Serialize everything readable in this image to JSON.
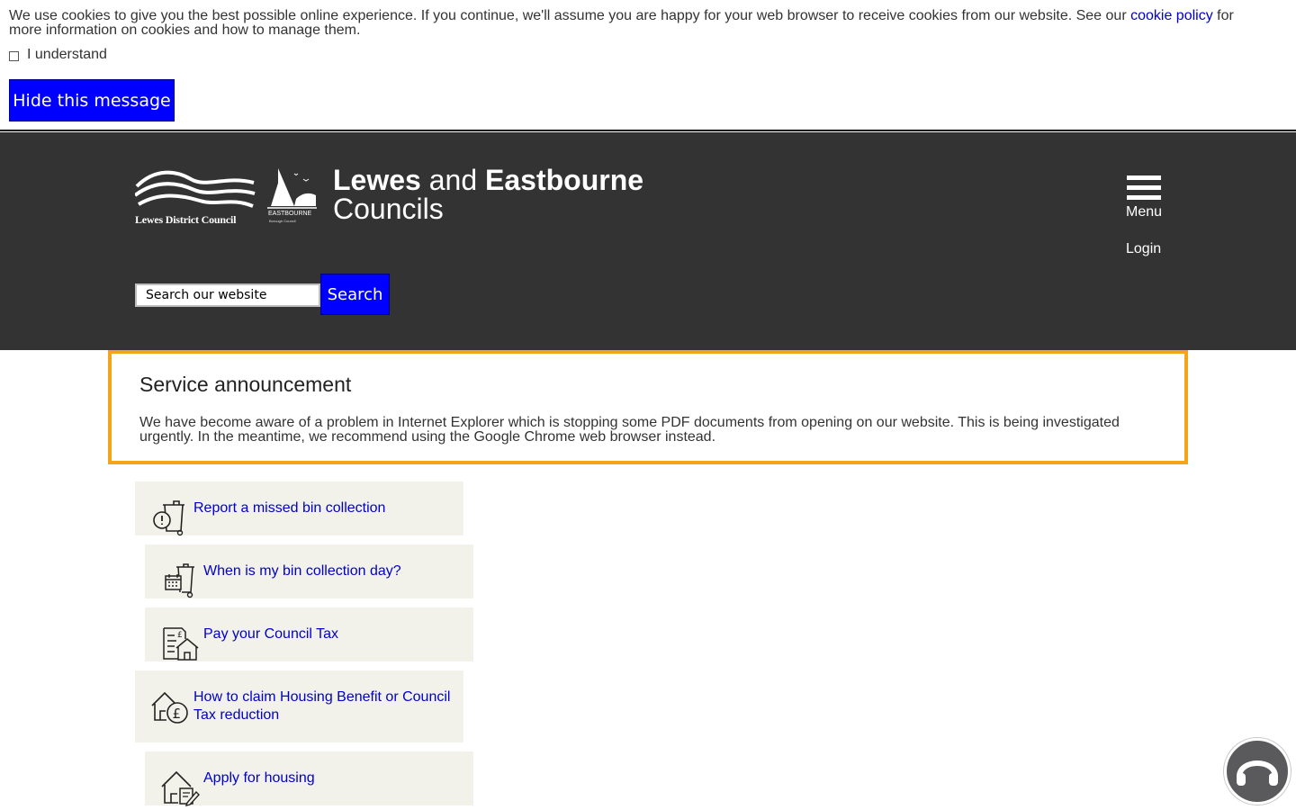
{
  "cookie_banner": {
    "text_before_link": "We use cookies to give you the best possible online experience. If you continue, we'll assume you are happy for your web browser to receive cookies from our website. See our",
    "link_text": "cookie policy",
    "text_after_link": "for more information on cookies and how to manage them.",
    "checkbox_label": "I understand",
    "hide_button_label": "Hide this message"
  },
  "header": {
    "lewes_logo_text": "Lewes District Council",
    "eastbourne_logo_text": "EASTBOURNE",
    "eastbourne_logo_subtext": "Borough Council",
    "title_word_1": "Lewes",
    "title_connector": "and",
    "title_word_2": "Eastbourne",
    "title_line_2": "Councils",
    "menu_label": "Menu",
    "login_label": "Login",
    "search_value": "Search our website",
    "search_button_label": "Search"
  },
  "announcement": {
    "title": "Service announcement",
    "text": "We have become aware of a problem in Internet Explorer which is stopping some PDF documents from opening on our website. This is being investigated urgently. In the meantime, we recommend using the Google Chrome web browser instead."
  },
  "quick_links": [
    {
      "label": "Report a missed bin collection",
      "icon": "bin-alert-icon"
    },
    {
      "label": "When is my bin collection day?",
      "icon": "bin-calendar-icon"
    },
    {
      "label": "Pay your Council Tax",
      "icon": "council-tax-icon"
    },
    {
      "label": "How to claim Housing Benefit or Council Tax reduction",
      "icon": "house-pound-icon"
    },
    {
      "label": "Apply for housing",
      "icon": "house-form-icon"
    }
  ],
  "accessibility": {
    "icon": "headphones-icon"
  },
  "colors": {
    "header_bg": "#333333",
    "button_blue": "#0000ff",
    "announcement_border": "#f4a417",
    "quick_link_bg": "#f3f2ea",
    "link_blue": "#0000cc"
  }
}
